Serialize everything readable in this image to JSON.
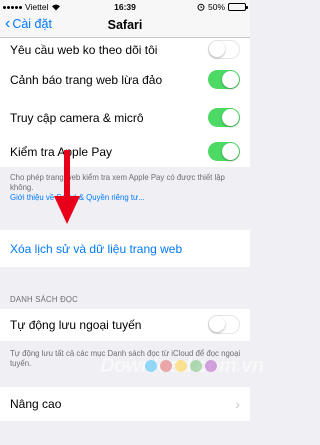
{
  "status_bar": {
    "carrier": "Viettel",
    "time": "16:39",
    "battery": "50%",
    "battery_level": 0.5
  },
  "nav": {
    "back_label": "Cài đặt",
    "title": "Safari"
  },
  "privacy_rows": [
    {
      "label": "Yêu cầu web ko theo dõi tôi",
      "toggle": "off"
    },
    {
      "label": "Cảnh báo trang web lừa đảo",
      "toggle": "on"
    },
    {
      "label": "Truy cập camera & micrô",
      "toggle": "on"
    },
    {
      "label": "Kiểm tra Apple Pay",
      "toggle": "on"
    }
  ],
  "apple_pay_footnote": "Cho phép trang web kiểm tra xem Apple Pay có được thiết lập không.",
  "apple_pay_link": "Giới thiệu về Safari & Quyền riêng tư...",
  "clear_history_label": "Xóa lịch sử và dữ liệu trang web",
  "reading_list": {
    "header": "DANH SÁCH ĐỌC",
    "row_label": "Tự động lưu ngoại tuyến",
    "toggle": "off",
    "footnote": "Tự động lưu tất cả các mục Danh sách đọc từ iCloud để đọc ngoại tuyến."
  },
  "advanced_label": "Nâng cao",
  "watermark": "Download.com.vn",
  "colors": {
    "accent": "#007aff",
    "toggle_on": "#4cd964",
    "arrow": "#e8001a"
  }
}
